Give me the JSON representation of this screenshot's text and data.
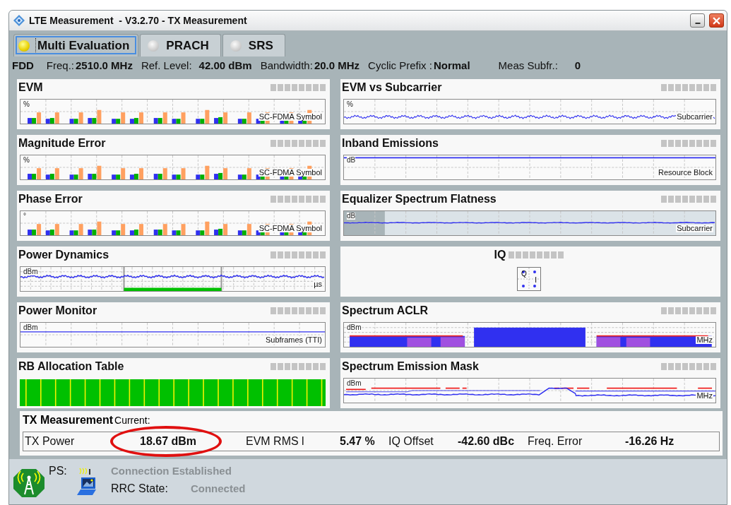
{
  "window": {
    "title": "LTE Measurement  - V3.2.70 - TX Measurement"
  },
  "tabs": [
    {
      "label": "Multi Evaluation",
      "selected": true
    },
    {
      "label": "PRACH",
      "selected": false
    },
    {
      "label": "SRS",
      "selected": false
    }
  ],
  "settings": [
    {
      "label": "FDD"
    },
    {
      "label": "Freq.:",
      "value": "2510.0 MHz"
    },
    {
      "label": "Ref. Level:",
      "value": "42.00 dBm"
    },
    {
      "label": "Bandwidth:",
      "value": "20.0 MHz"
    },
    {
      "label": "Cyclic Prefix :",
      "value": "Normal"
    },
    {
      "label": "Meas Subfr.:",
      "value": "0"
    }
  ],
  "panels": [
    {
      "title": "EVM",
      "kind": "bars",
      "unit": "%",
      "axis_label": "SC-FDMA Symbol"
    },
    {
      "title": "EVM vs Subcarrier",
      "kind": "noise",
      "unit": "%",
      "axis_label": "Subcarrier"
    },
    {
      "title": "Magnitude Error",
      "kind": "bars",
      "unit": "%",
      "axis_label": "SC-FDMA Symbol"
    },
    {
      "title": "Inband Emissions",
      "kind": "flat",
      "unit": "dB",
      "axis_label": "Resource Block"
    },
    {
      "title": "Phase Error",
      "kind": "bars",
      "unit": "°",
      "axis_label": "SC-FDMA Symbol"
    },
    {
      "title": "Equalizer Spectrum Flatness",
      "kind": "flatness",
      "unit": "dB",
      "axis_label": "Subcarrier"
    },
    {
      "title": "Power Dynamics",
      "kind": "dynamics",
      "unit": "dBm",
      "axis_label": "µs"
    },
    {
      "title": "IQ",
      "kind": "iq",
      "unit": "Q",
      "axis_label": "I"
    },
    {
      "title": "Power Monitor",
      "kind": "monitor",
      "unit": "dBm",
      "axis_label": "Subframes (TTI)"
    },
    {
      "title": "Spectrum ACLR",
      "kind": "aclr",
      "unit": "dBm",
      "axis_label": "MHz"
    },
    {
      "title": "RB Allocation Table",
      "kind": "rb"
    },
    {
      "title": "Spectrum Emission Mask",
      "kind": "sem",
      "unit": "dBm",
      "axis_label": "MHz"
    }
  ],
  "tx_measurement": {
    "title": "TX Measurement",
    "subtitle": "Current:",
    "results": [
      {
        "label": "TX Power",
        "value": "18.67 dBm",
        "highlighted": true
      },
      {
        "label": "EVM RMS l",
        "value": "5.47 %",
        "highlighted": false
      },
      {
        "label": "IQ Offset",
        "value": "-42.60 dBc",
        "highlighted": false
      },
      {
        "label": "Freq. Error",
        "value": "-16.26 Hz",
        "highlighted": false
      }
    ]
  },
  "status": {
    "ps_label": "PS:",
    "connection": "Connection Established",
    "rrc_label": "RRC State:",
    "rrc_value": "Connected"
  }
}
